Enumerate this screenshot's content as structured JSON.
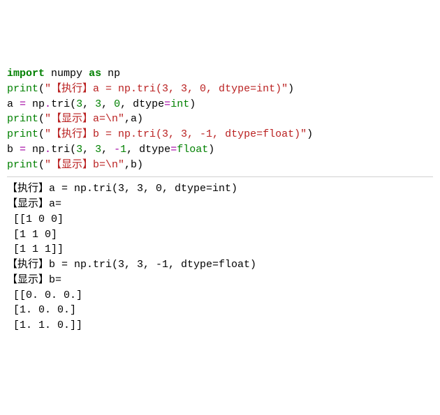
{
  "code": {
    "l1": {
      "import": "import",
      "numpy": "numpy",
      "as": "as",
      "np": "np"
    },
    "l2": {
      "print": "print",
      "op": "(",
      "str": "\"【执行】a = np.tri(3, 3, 0, dtype=int)\"",
      "cp": ")"
    },
    "l3": {
      "a": "a ",
      "eq": "=",
      "sp": " np",
      "dot": ".",
      "tri": "tri(",
      "n1": "3",
      "c1": ", ",
      "n2": "3",
      "c2": ", ",
      "n3": "0",
      "c3": ", dtype",
      "eq2": "=",
      "int": "int",
      "cp": ")"
    },
    "l4": {
      "print": "print",
      "op": "(",
      "str": "\"【显示】a=\\n\"",
      "c": ",a)",
      "cp": ""
    },
    "l5": {
      "print": "print",
      "op": "(",
      "str": "\"【执行】b = np.tri(3, 3, -1, dtype=float)\"",
      "cp": ")"
    },
    "l6": {
      "b": "b ",
      "eq": "=",
      "sp": " np",
      "dot": ".",
      "tri": "tri(",
      "n1": "3",
      "c1": ", ",
      "n2": "3",
      "c2": ", ",
      "neg": "-",
      "n3": "1",
      "c3": ", dtype",
      "eq2": "=",
      "float": "float",
      "cp": ")"
    },
    "l7": {
      "print": "print",
      "op": "(",
      "str": "\"【显示】b=\\n\"",
      "c": ",b)"
    }
  },
  "output": {
    "l1": "【执行】a = np.tri(3, 3, 0, dtype=int)",
    "l2": "【显示】a=",
    "l3": " [[1 0 0]",
    "l4": " [1 1 0]",
    "l5": " [1 1 1]]",
    "l6": "【执行】b = np.tri(3, 3, -1, dtype=float)",
    "l7": "【显示】b=",
    "l8": " [[0. 0. 0.]",
    "l9": " [1. 0. 0.]",
    "l10": " [1. 1. 0.]]"
  }
}
